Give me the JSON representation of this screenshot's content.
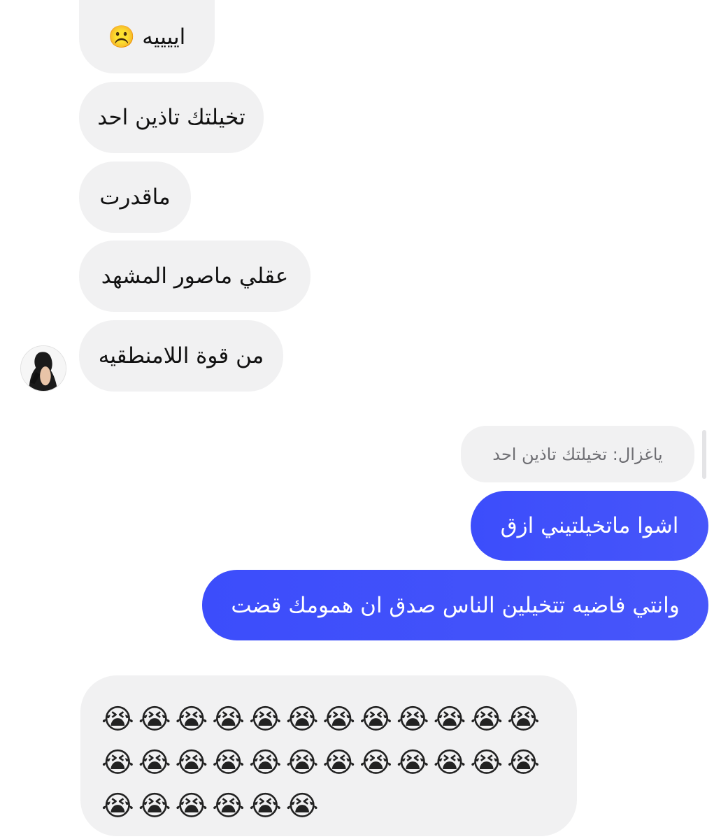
{
  "received_messages": [
    {
      "text": "اييييه ☹️"
    },
    {
      "text": "تخيلتك تاذين احد"
    },
    {
      "text": "ماقدرت"
    },
    {
      "text": "عقلي ماصور المشهد"
    },
    {
      "text": "من قوة اللامنطقيه"
    }
  ],
  "reply_quote": {
    "text": "ياغزال: تخيلتك تاذين احد"
  },
  "sent_messages": [
    {
      "text": "اشوا ماتخيلتيني ازق"
    },
    {
      "text": "وانتي فاضيه تتخيلين الناس صدق ان همومك قضت"
    }
  ],
  "emoji_message": {
    "text": "😭😭😭😭😭😭😭😭😭😭😭😭😭😭😭😭😭😭😭😭😭😭😭😭😭😭😭😭😭😭"
  },
  "colors": {
    "received_bubble": "#f1f1f2",
    "sent_bubble": "#3c4dfb",
    "sent_text": "#ffffff"
  },
  "avatar": {
    "icon": "contact-avatar"
  }
}
